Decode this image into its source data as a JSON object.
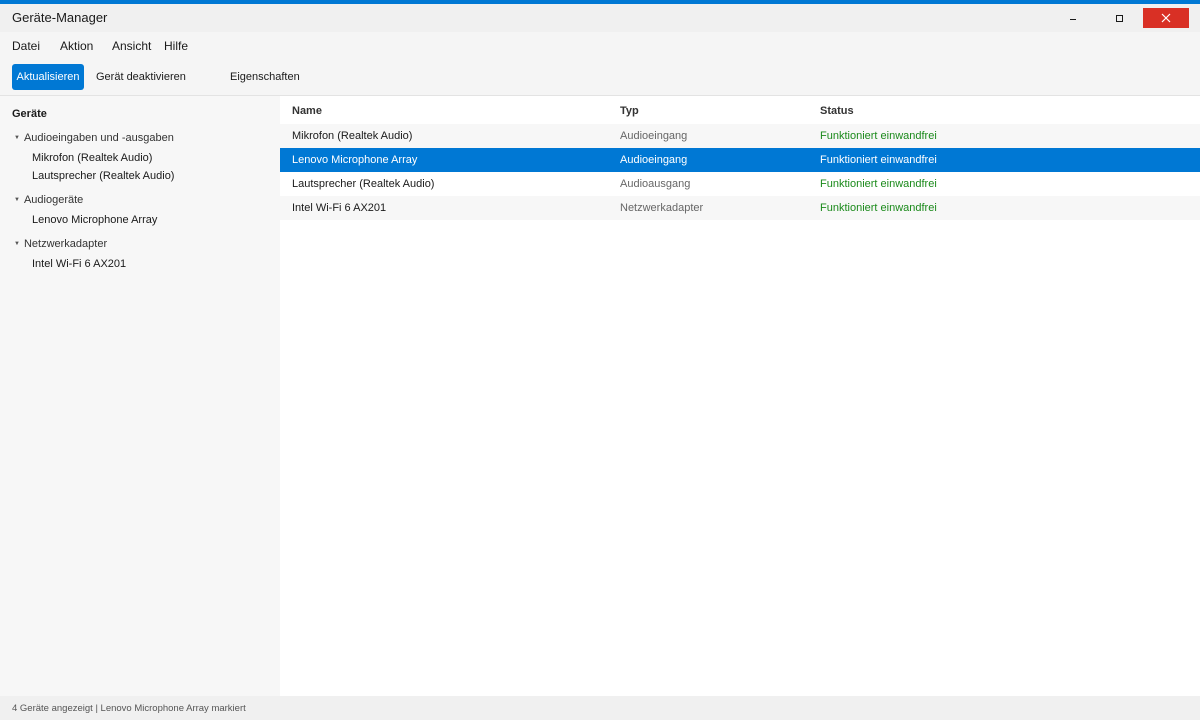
{
  "window": {
    "title": "Geräte-Manager",
    "close_glyph": "✕",
    "accent_color": "#0078d4"
  },
  "menu": [
    "Datei",
    "Aktion",
    "Ansicht",
    "Hilfe"
  ],
  "toolbar": {
    "refresh_label": "Aktualisieren",
    "deactivate_label": "Gerät deaktivieren",
    "properties_label": "Eigenschaften"
  },
  "sidebar": {
    "heading": "Geräte",
    "groups": [
      {
        "label": "Audioeingaben und -ausgaben",
        "children": [
          "Mikrofon (Realtek Audio)",
          "Lautsprecher (Realtek Audio)"
        ]
      },
      {
        "label": "Audiogeräte",
        "children": [
          "Lenovo Microphone Array"
        ]
      },
      {
        "label": "Netzwerkadapter",
        "children": [
          "Intel Wi-Fi 6 AX201"
        ]
      }
    ]
  },
  "list": {
    "columns": [
      "Name",
      "Typ",
      "Status"
    ],
    "rows": [
      {
        "name": "Mikrofon (Realtek Audio)",
        "typ": "Audioeingang",
        "status": "Funktioniert einwandfrei"
      },
      {
        "name": "Lenovo Microphone Array",
        "typ": "Audioeingang",
        "status": "Funktioniert einwandfrei"
      },
      {
        "name": "Lautsprecher (Realtek Audio)",
        "typ": "Audioausgang",
        "status": "Funktioniert einwandfrei"
      },
      {
        "name": "Intel Wi-Fi 6 AX201",
        "typ": "Netzwerkadapter",
        "status": "Funktioniert einwandfrei"
      }
    ],
    "selected_row": "Lenovo Microphone Array"
  },
  "status_bar": {
    "text": "4 Geräte angezeigt | Lenovo Microphone Array markiert"
  }
}
